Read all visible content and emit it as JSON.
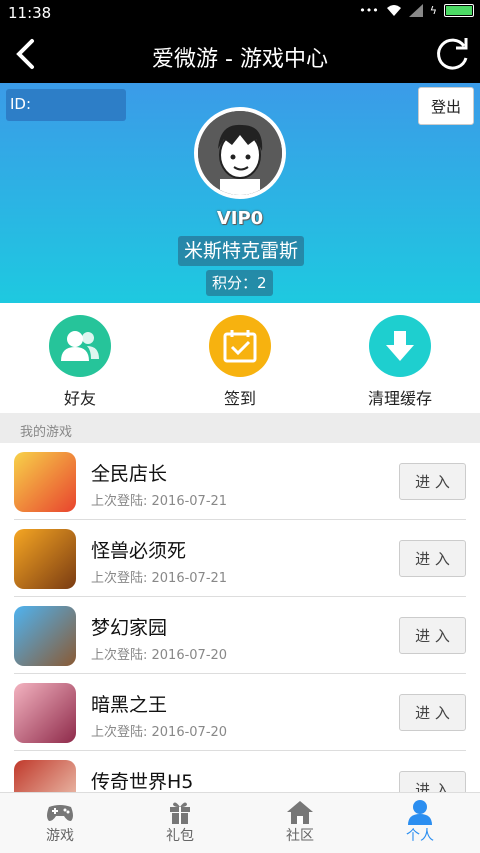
{
  "status": {
    "time": "11:38"
  },
  "header": {
    "title": "爱微游 - 游戏中心"
  },
  "profile": {
    "id_label": "ID:",
    "logout_label": "登出",
    "vip": "VIP0",
    "username": "米斯特克雷斯",
    "points": "积分：2"
  },
  "actions": [
    {
      "label": "好友",
      "color": "#26c49a",
      "icon": "friends-icon"
    },
    {
      "label": "签到",
      "color": "#f7b20f",
      "icon": "checkin-icon"
    },
    {
      "label": "清理缓存",
      "color": "#1ecfcf",
      "icon": "download-icon"
    }
  ],
  "section_title": "我的游戏",
  "games": [
    {
      "name": "全民店长",
      "date": "上次登陆: 2016-07-21",
      "button": "进 入"
    },
    {
      "name": "怪兽必须死",
      "date": "上次登陆: 2016-07-21",
      "button": "进 入"
    },
    {
      "name": "梦幻家园",
      "date": "上次登陆: 2016-07-20",
      "button": "进 入"
    },
    {
      "name": "暗黑之王",
      "date": "上次登陆: 2016-07-20",
      "button": "进 入"
    },
    {
      "name": "传奇世界H5",
      "date": "",
      "button": "进 入"
    }
  ],
  "tabs": [
    {
      "label": "游戏",
      "icon": "gamepad-icon"
    },
    {
      "label": "礼包",
      "icon": "gift-icon"
    },
    {
      "label": "社区",
      "icon": "home-icon"
    },
    {
      "label": "个人",
      "icon": "person-icon"
    }
  ],
  "colors": {
    "accent": "#2b8ef0",
    "header_bg": "#000000"
  }
}
